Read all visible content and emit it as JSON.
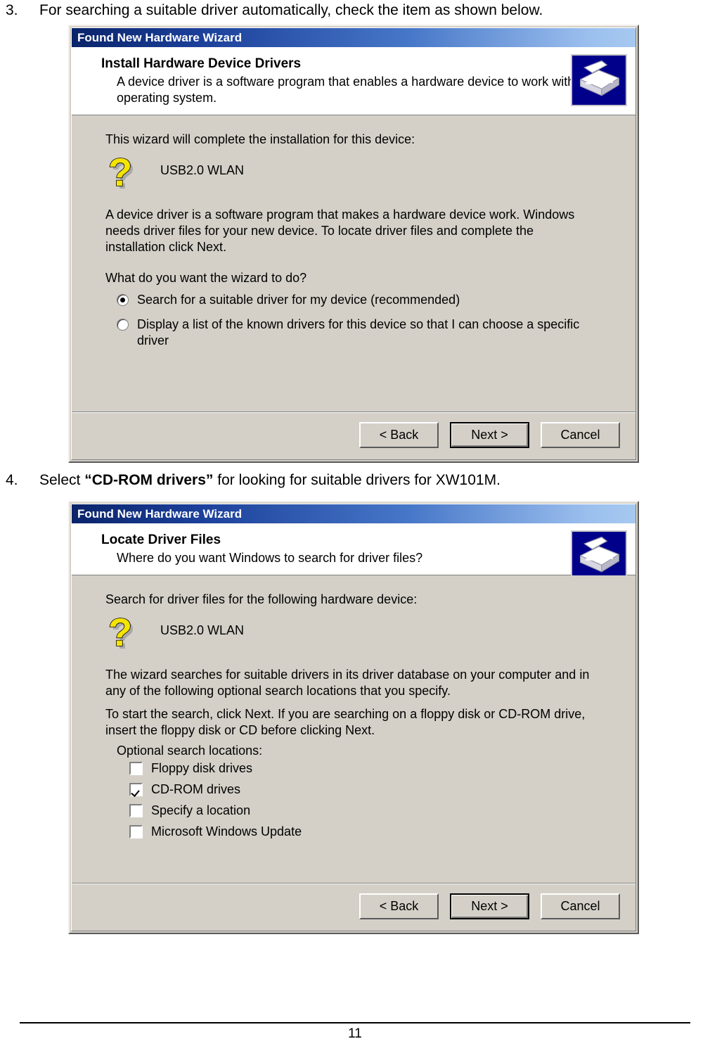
{
  "document": {
    "page_number": "11",
    "steps": [
      {
        "number": "3.",
        "text": "For searching a suitable driver automatically, check the item as shown below."
      },
      {
        "number": "4.",
        "text_before": "Select ",
        "emphasis": "“CD-ROM drivers”",
        "text_after": " for looking for suitable drivers for XW101M."
      }
    ]
  },
  "dialog_install": {
    "titlebar": "Found New Hardware Wizard",
    "header": {
      "title": "Install Hardware Device Drivers",
      "subtitle": "A device driver is a software program that enables a hardware device to work with an operating system.",
      "icon": "hardware-device-icon"
    },
    "body": {
      "intro": "This wizard will complete the installation for this device:",
      "device_icon": "unknown-device-question-icon",
      "device_name": "USB2.0 WLAN",
      "description": "A device driver is a software program that makes a hardware device work. Windows needs driver files for your new device. To locate driver files and complete the installation click Next.",
      "question": "What do you want the wizard to do?",
      "options": [
        {
          "label": "Search for a suitable driver for my device (recommended)",
          "selected": true
        },
        {
          "label": "Display a list of the known drivers for this device so that I can choose a specific driver",
          "selected": false
        }
      ]
    },
    "buttons": [
      {
        "label": "< Back",
        "default": false
      },
      {
        "label": "Next >",
        "default": true
      },
      {
        "label": "Cancel",
        "default": false
      }
    ]
  },
  "dialog_locate": {
    "titlebar": "Found New Hardware Wizard",
    "header": {
      "title": "Locate Driver Files",
      "subtitle": "Where do you want Windows to search for driver files?",
      "icon": "hardware-device-icon"
    },
    "body": {
      "intro": "Search for driver files for the following hardware device:",
      "device_icon": "unknown-device-question-icon",
      "device_name": "USB2.0 WLAN",
      "description_1": "The wizard searches for suitable drivers in its driver database on your computer and in any of the following optional search locations that you specify.",
      "description_2": "To start the search, click Next. If you are searching on a floppy disk or CD-ROM drive, insert the floppy disk or CD before clicking Next.",
      "group_label": "Optional search locations:",
      "checkboxes": [
        {
          "label": "Floppy disk drives",
          "checked": false
        },
        {
          "label": "CD-ROM drives",
          "checked": true
        },
        {
          "label": "Specify a location",
          "checked": false
        },
        {
          "label": "Microsoft Windows Update",
          "checked": false
        }
      ]
    },
    "buttons": [
      {
        "label": "< Back",
        "default": false
      },
      {
        "label": "Next >",
        "default": true
      },
      {
        "label": "Cancel",
        "default": false
      }
    ]
  },
  "colors": {
    "titlebar_start": "#0a246a",
    "titlebar_end": "#a6c9f0",
    "dialog_face": "#d4d0c8",
    "header_bg": "#ffffff",
    "device_icon_yellow": "#f5e400",
    "header_icon_blue": "#00008b"
  }
}
